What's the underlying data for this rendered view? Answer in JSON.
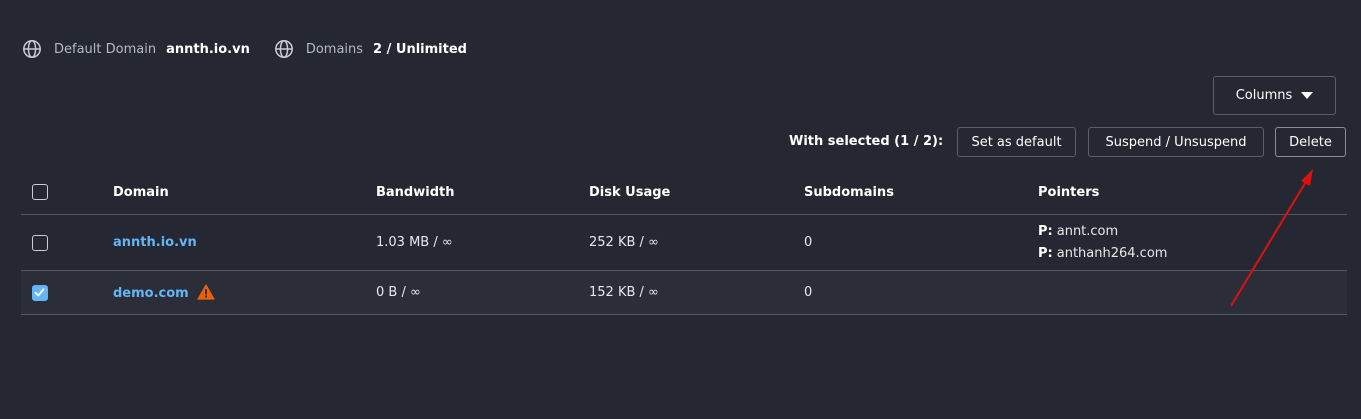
{
  "info": {
    "default_domain_label": "Default Domain",
    "default_domain_value": "annth.io.vn",
    "domains_label": "Domains",
    "domains_value": "2 / Unlimited"
  },
  "toolbar": {
    "columns_label": "Columns",
    "with_selected_label": "With selected (1 / 2):",
    "set_default_label": "Set as default",
    "suspend_label": "Suspend / Unsuspend",
    "delete_label": "Delete"
  },
  "table": {
    "headers": {
      "domain": "Domain",
      "bandwidth": "Bandwidth",
      "disk": "Disk Usage",
      "subdomains": "Subdomains",
      "pointers": "Pointers"
    },
    "rows": [
      {
        "checked": false,
        "domain": "annth.io.vn",
        "bandwidth": "1.03 MB / ∞",
        "disk": "252 KB / ∞",
        "subdomains": "0",
        "pointers": [
          {
            "prefix": "P:",
            "value": "annt.com"
          },
          {
            "prefix": "P:",
            "value": "anthanh264.com"
          }
        ]
      },
      {
        "checked": true,
        "warning": true,
        "domain": "demo.com",
        "bandwidth": "0 B / ∞",
        "disk": "152 KB / ∞",
        "subdomains": "0",
        "pointers": []
      }
    ]
  },
  "colors": {
    "background": "#252832",
    "link": "#64b5f6",
    "warning": "#e8610a",
    "annotation_arrow": "#e01010"
  },
  "icons": [
    "globe-icon",
    "caret-down-icon",
    "checkbox-icon",
    "warning-icon",
    "annotation-arrow"
  ]
}
